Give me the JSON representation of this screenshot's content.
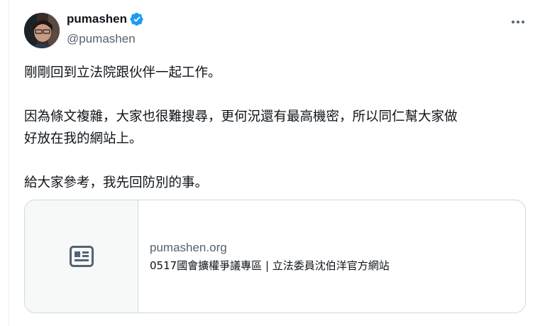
{
  "author": {
    "display_name": "pumashen",
    "handle": "@pumashen",
    "verified": true,
    "avatar_icon": "profile-photo"
  },
  "menu": {
    "icon": "more-horizontal-icon"
  },
  "tweet": {
    "paragraphs": [
      "剛剛回到立法院跟伙伴一起工作。",
      "因為條文複雜，大家也很難搜尋，更何況還有最高機密，所以同仁幫大家做好放在我的網站上。",
      "給大家參考，我先回防別的事。"
    ],
    "line2a": "因為條文複雜，大家也很難搜尋，更何況還有最高機密，所以同仁幫大家做",
    "line2b": "好放在我的網站上。"
  },
  "link_card": {
    "domain": "pumashen.org",
    "title": "0517國會擴權爭議專區 | 立法委員沈伯洋官方網站",
    "thumb_icon": "article-icon"
  },
  "colors": {
    "text": "#0f1419",
    "secondary": "#536471",
    "verified": "#1d9bf0",
    "border": "#cfd9de",
    "thumb_bg": "#f7f9f9"
  }
}
